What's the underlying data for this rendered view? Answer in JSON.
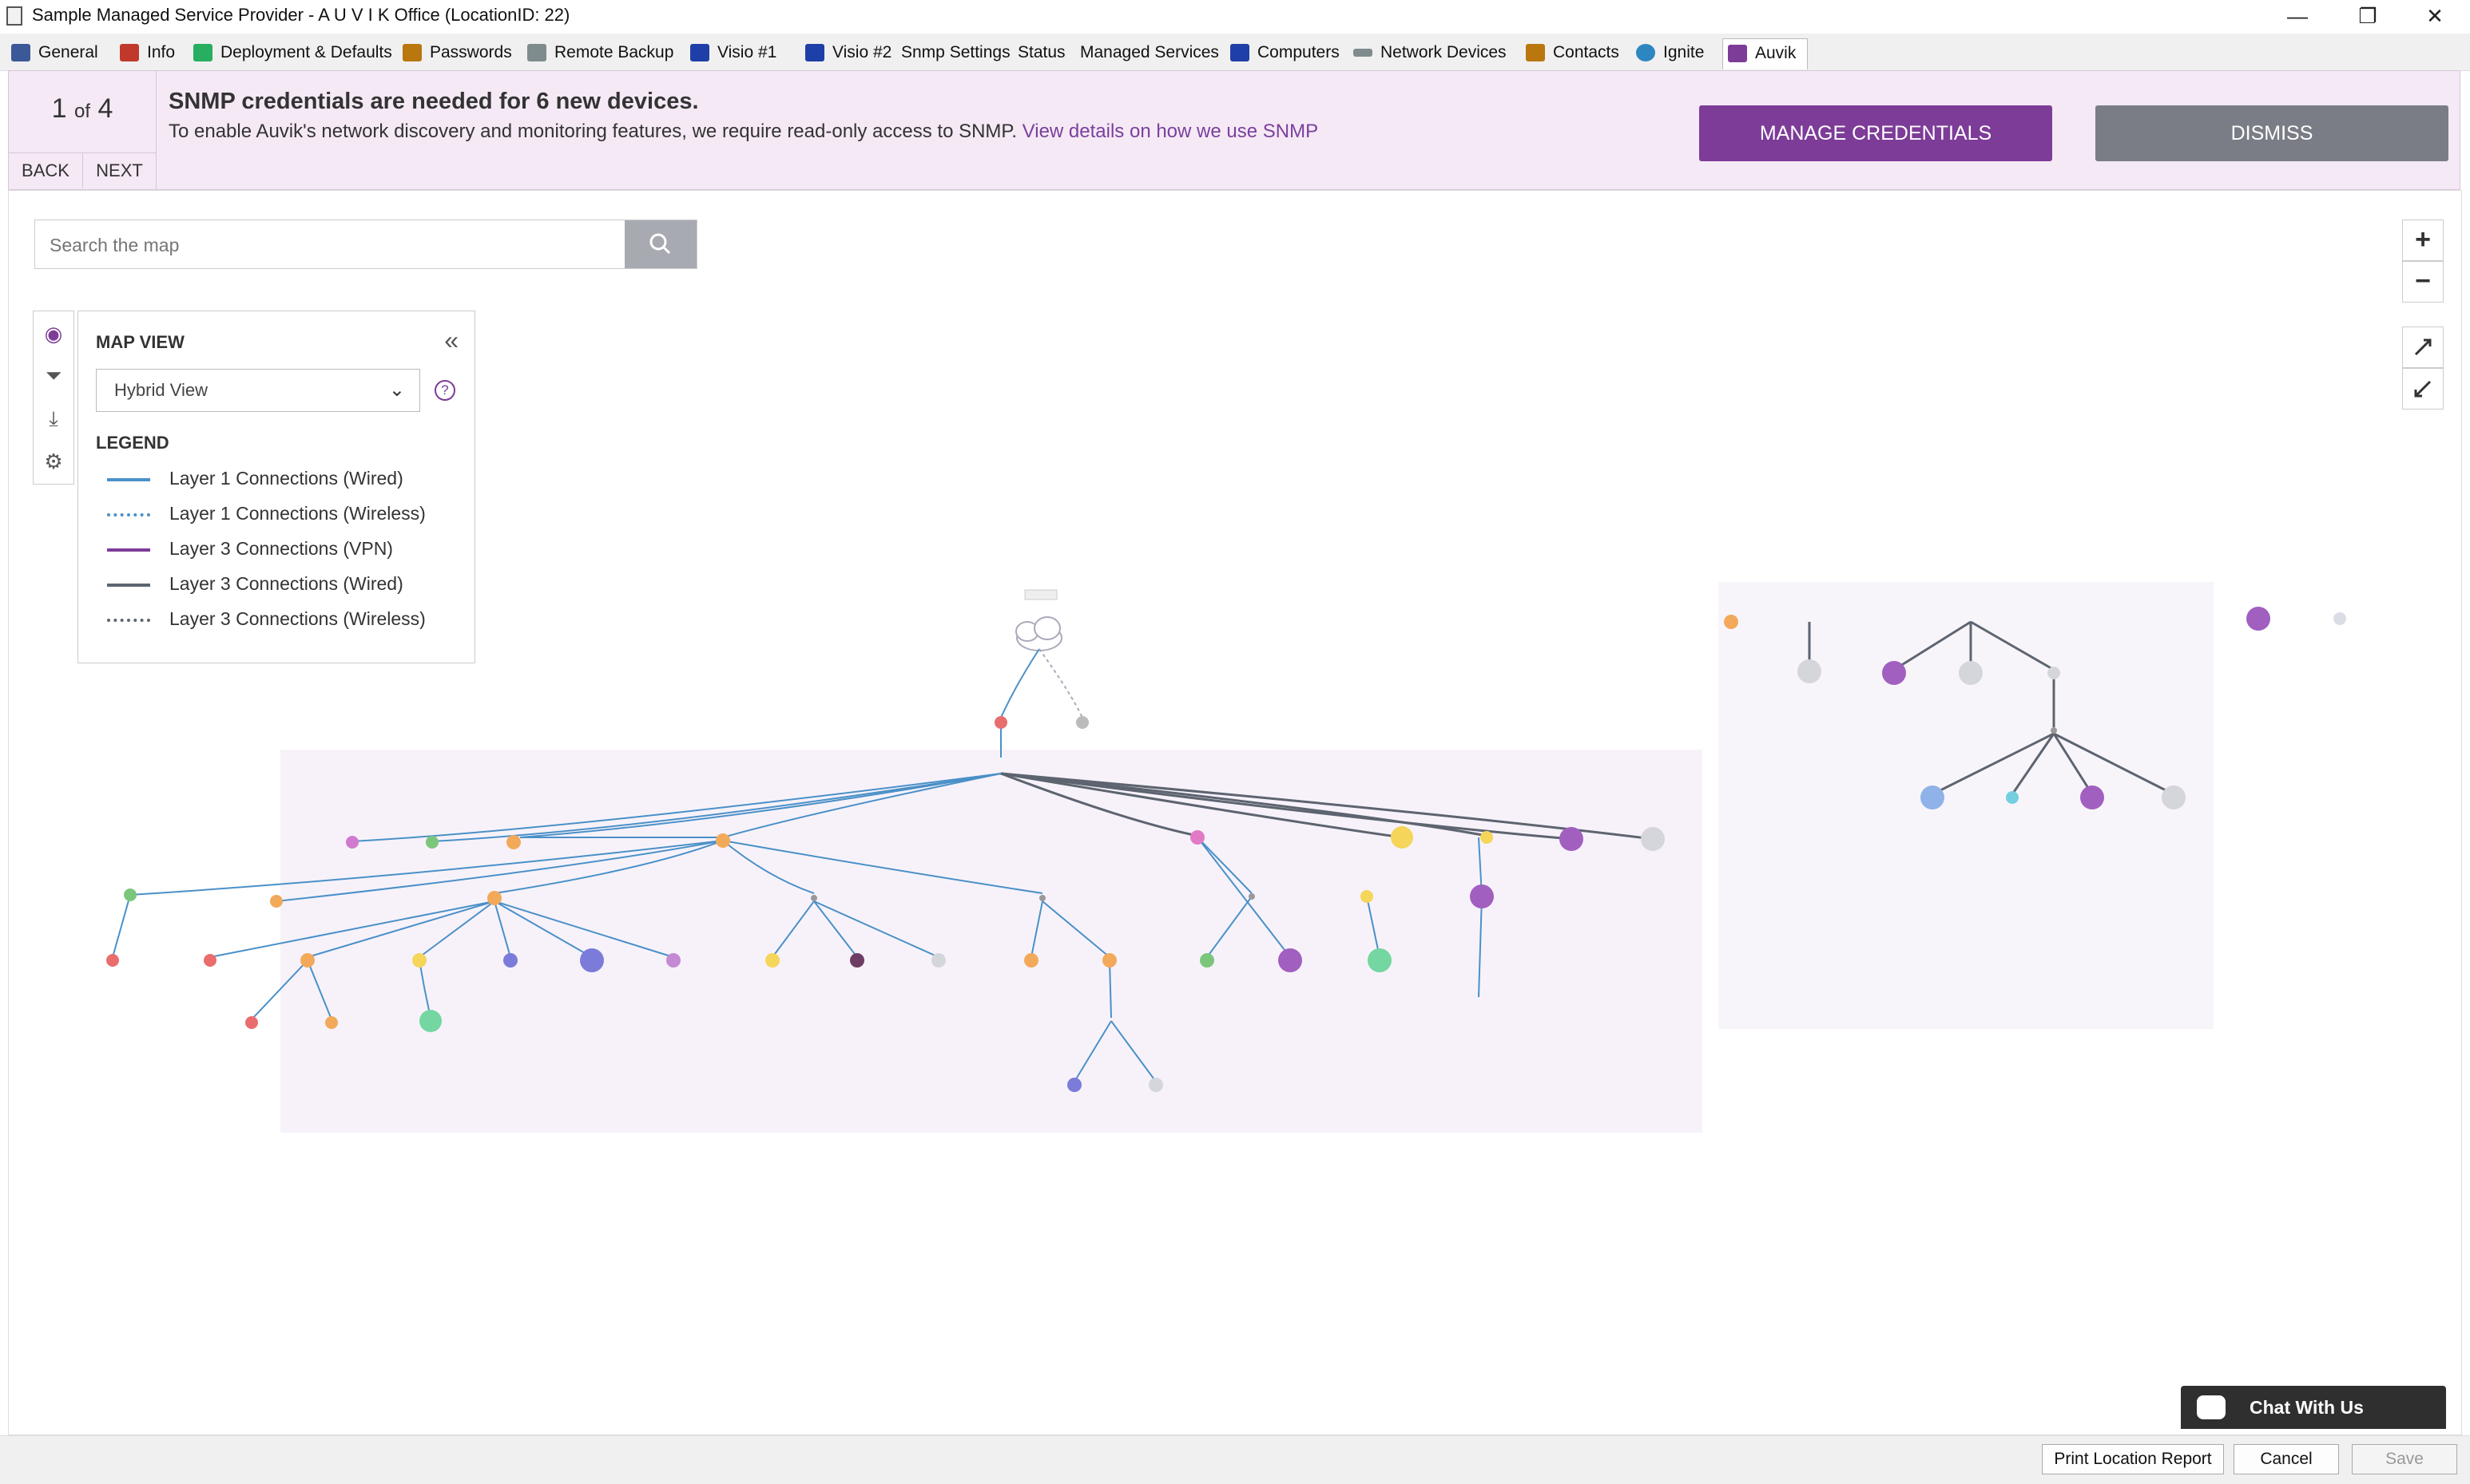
{
  "window": {
    "title": "Sample Managed Service Provider - A U V I K Office    (LocationID: 22)",
    "minimize_label": "—",
    "restore_label": "❐",
    "close_label": "✕"
  },
  "tabs": [
    {
      "label": "General",
      "icon": "general-icon",
      "color": "#3b5998"
    },
    {
      "label": "Info",
      "icon": "info-icon",
      "color": "#c0392b"
    },
    {
      "label": "Deployment & Defaults",
      "icon": "deployment-icon",
      "color": "#27ae60"
    },
    {
      "label": "Passwords",
      "icon": "passwords-icon",
      "color": "#b9770e"
    },
    {
      "label": "Remote Backup",
      "icon": "remote-backup-icon",
      "color": "#7f8c8d"
    },
    {
      "label": "Visio #1",
      "icon": "visio-icon",
      "color": "#1f3fa8"
    },
    {
      "label": "Visio #2",
      "icon": "visio-icon",
      "color": "#1f3fa8"
    },
    {
      "label": "Snmp Settings",
      "icon": "",
      "color": ""
    },
    {
      "label": "Status",
      "icon": "",
      "color": ""
    },
    {
      "label": "Managed Services",
      "icon": "",
      "color": ""
    },
    {
      "label": "Computers",
      "icon": "computers-icon",
      "color": "#1f3fa8"
    },
    {
      "label": "Network Devices",
      "icon": "network-devices-icon",
      "color": "#7f8c8d"
    },
    {
      "label": "Contacts",
      "icon": "contacts-icon",
      "color": "#b9770e"
    },
    {
      "label": "Ignite",
      "icon": "ignite-icon",
      "color": "#2e86c1"
    },
    {
      "label": "Auvik",
      "icon": "auvik-icon",
      "color": "#7d3c98"
    }
  ],
  "banner": {
    "page_current": "1",
    "page_of": "of",
    "page_total": "4",
    "back_label": "BACK",
    "next_label": "NEXT",
    "heading": "SNMP credentials are needed for 6 new devices.",
    "body": "To enable Auvik's network discovery and monitoring features, we require read-only access to SNMP.",
    "link": "View details on how we use SNMP",
    "manage_label": "MANAGE CREDENTIALS",
    "dismiss_label": "DISMISS"
  },
  "map": {
    "search_placeholder": "Search the map",
    "zoom_in": "+",
    "zoom_out": "−",
    "panel_title": "MAP VIEW",
    "view_selected": "Hybrid View",
    "legend_title": "LEGEND",
    "legend": [
      {
        "label": "Layer 1 Connections (Wired)",
        "color": "#4a90c8",
        "style": "solid"
      },
      {
        "label": "Layer 1 Connections (Wireless)",
        "color": "#4a90c8",
        "style": "dotted"
      },
      {
        "label": "Layer 3 Connections (VPN)",
        "color": "#7d3c98",
        "style": "solid"
      },
      {
        "label": "Layer 3 Connections (Wired)",
        "color": "#5d6470",
        "style": "solid"
      },
      {
        "label": "Layer 3 Connections (Wireless)",
        "color": "#5d6470",
        "style": "dotted"
      }
    ],
    "icons": [
      "eye-icon",
      "filter-icon",
      "download-icon",
      "gear-icon",
      "search-icon",
      "expand-icon",
      "compress-icon"
    ]
  },
  "chat_label": "Chat With Us",
  "footer": {
    "print_label": "Print Location Report",
    "cancel_label": "Cancel",
    "save_label": "Save"
  },
  "colors": {
    "accent": "#7d3c98",
    "banner_bg": "#f4e9f5",
    "dismiss": "#7a7d85"
  }
}
